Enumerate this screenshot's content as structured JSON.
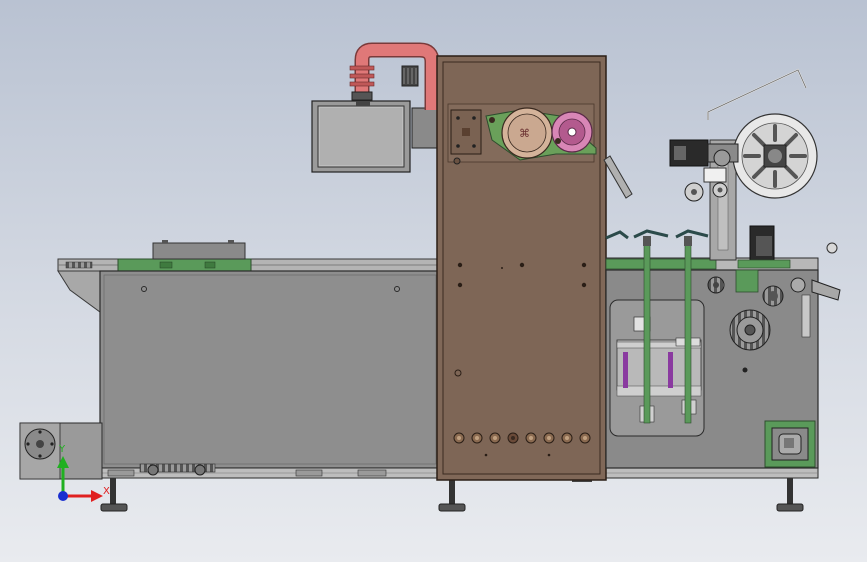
{
  "triad": {
    "x_label": "X",
    "y_label": "Y",
    "x_color": "#e02020",
    "y_color": "#20b020",
    "origin_color": "#1a2fd0"
  },
  "colors": {
    "background_top": "#b9c2d2",
    "background_bottom": "#e9ebef",
    "frame_grey": "#8e8e8e",
    "cabinet_brown": "#806858",
    "duct_pink": "#e07878",
    "sealing_wheel_pink": "#d886b6",
    "rail_green": "#5a9a5a",
    "purple_rod": "#8a3aa0",
    "steel_light": "#c8c8c8",
    "motor_dark": "#2a2a2a"
  }
}
